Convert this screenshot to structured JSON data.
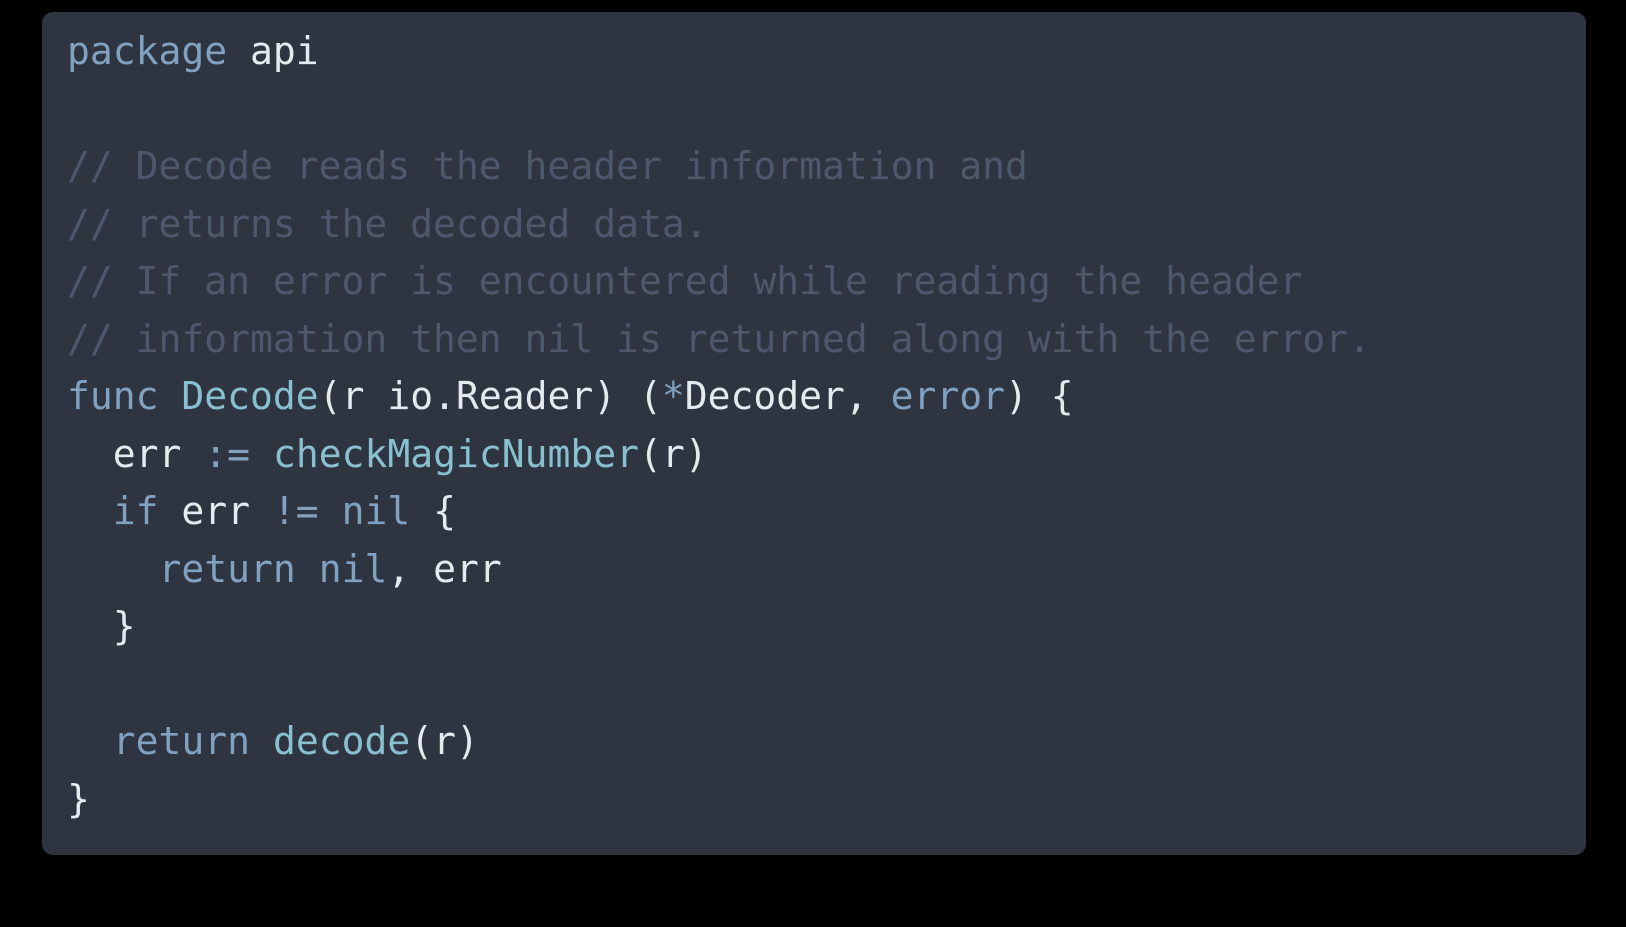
{
  "window": {
    "background_color": "#000000",
    "card_background_color": "#2e3440",
    "card_corner_radius_px": 11
  },
  "theme": {
    "name": "nord-dark",
    "keyword_color": "#81a1c1",
    "function_color": "#88c0d0",
    "plain_color": "#e5e9f0",
    "comment_color": "#4f586b",
    "background_color": "#2e3440"
  },
  "editor": {
    "language": "go",
    "font_size_px": 38,
    "line_height_px": 57.5,
    "line_count": 14
  },
  "code": {
    "plain_text": "package api\n\n// Decode reads the header information and\n// returns the decoded data.\n// If an error is encountered while reading the header\n// information then nil is returned along with the error.\nfunc Decode(r io.Reader) (*Decoder, error) {\n  err := checkMagicNumber(r)\n  if err != nil {\n    return nil, err\n  }\n\n  return decode(r)\n}",
    "lines": [
      {
        "index": 1,
        "text": "package api",
        "tokens": [
          {
            "t": "package",
            "k": "kw"
          },
          {
            "t": " ",
            "k": "plain"
          },
          {
            "t": "api",
            "k": "plain"
          }
        ]
      },
      {
        "index": 2,
        "text": "",
        "tokens": []
      },
      {
        "index": 3,
        "text": "// Decode reads the header information and",
        "tokens": [
          {
            "t": "// Decode reads the header information and",
            "k": "comment"
          }
        ]
      },
      {
        "index": 4,
        "text": "// returns the decoded data.",
        "tokens": [
          {
            "t": "// returns the decoded data.",
            "k": "comment"
          }
        ]
      },
      {
        "index": 5,
        "text": "// If an error is encountered while reading the header",
        "tokens": [
          {
            "t": "// If an error is encountered while reading the header",
            "k": "comment"
          }
        ]
      },
      {
        "index": 6,
        "text": "// information then nil is returned along with the error.",
        "tokens": [
          {
            "t": "// information then nil is returned along with the error.",
            "k": "comment"
          }
        ]
      },
      {
        "index": 7,
        "text": "func Decode(r io.Reader) (*Decoder, error) {",
        "tokens": [
          {
            "t": "func",
            "k": "kw"
          },
          {
            "t": " ",
            "k": "plain"
          },
          {
            "t": "Decode",
            "k": "fn"
          },
          {
            "t": "(r io.Reader) (",
            "k": "plain"
          },
          {
            "t": "*",
            "k": "kw"
          },
          {
            "t": "Decoder, ",
            "k": "plain"
          },
          {
            "t": "error",
            "k": "kw"
          },
          {
            "t": ") {",
            "k": "plain"
          }
        ]
      },
      {
        "index": 8,
        "text": "  err := checkMagicNumber(r)",
        "tokens": [
          {
            "t": "  err ",
            "k": "plain"
          },
          {
            "t": ":=",
            "k": "kw"
          },
          {
            "t": " ",
            "k": "plain"
          },
          {
            "t": "checkMagicNumber",
            "k": "fn"
          },
          {
            "t": "(r)",
            "k": "plain"
          }
        ]
      },
      {
        "index": 9,
        "text": "  if err != nil {",
        "tokens": [
          {
            "t": "  ",
            "k": "plain"
          },
          {
            "t": "if",
            "k": "kw"
          },
          {
            "t": " err ",
            "k": "plain"
          },
          {
            "t": "!=",
            "k": "kw"
          },
          {
            "t": " ",
            "k": "plain"
          },
          {
            "t": "nil",
            "k": "kw"
          },
          {
            "t": " {",
            "k": "plain"
          }
        ]
      },
      {
        "index": 10,
        "text": "    return nil, err",
        "tokens": [
          {
            "t": "    ",
            "k": "plain"
          },
          {
            "t": "return",
            "k": "kw"
          },
          {
            "t": " ",
            "k": "plain"
          },
          {
            "t": "nil",
            "k": "kw"
          },
          {
            "t": ", err",
            "k": "plain"
          }
        ]
      },
      {
        "index": 11,
        "text": "  }",
        "tokens": [
          {
            "t": "  }",
            "k": "plain"
          }
        ]
      },
      {
        "index": 12,
        "text": "",
        "tokens": []
      },
      {
        "index": 13,
        "text": "  return decode(r)",
        "tokens": [
          {
            "t": "  ",
            "k": "plain"
          },
          {
            "t": "return",
            "k": "kw"
          },
          {
            "t": " ",
            "k": "plain"
          },
          {
            "t": "decode",
            "k": "fn"
          },
          {
            "t": "(r)",
            "k": "plain"
          }
        ]
      },
      {
        "index": 14,
        "text": "}",
        "tokens": [
          {
            "t": "}",
            "k": "plain"
          }
        ]
      }
    ]
  }
}
